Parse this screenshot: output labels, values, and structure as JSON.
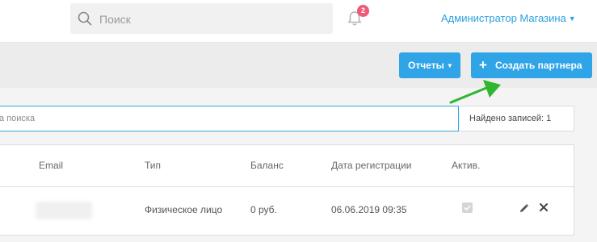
{
  "header": {
    "search_placeholder": "Поиск",
    "notifications_count": "2",
    "user_name": "Администратор Магазина"
  },
  "toolbar": {
    "reports_label": "Отчеты",
    "create_partner_label": "Создать партнера"
  },
  "filter": {
    "placeholder": "а поиска",
    "found_records": "Найдено записей: 1"
  },
  "table": {
    "columns": [
      "Email",
      "Тип",
      "Баланс",
      "Дата регистрации",
      "Актив."
    ],
    "rows": [
      {
        "email": "",
        "type": "Физическое лицо",
        "balance": "0 руб.",
        "registered": "06.06.2019 09:35",
        "active": true
      }
    ]
  },
  "colors": {
    "accent": "#2fa4e7",
    "badge": "#ef5a7a",
    "arrow": "#2fb62f"
  }
}
